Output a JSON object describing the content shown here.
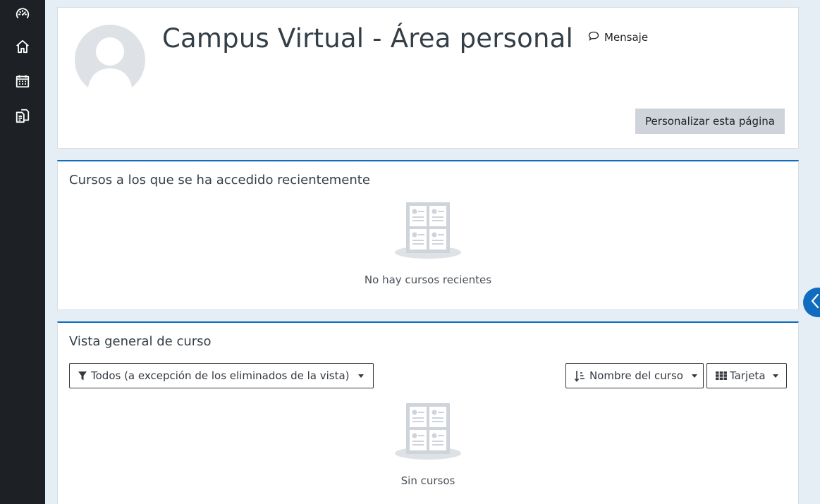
{
  "nav": {
    "items": [
      {
        "name": "dashboard-icon"
      },
      {
        "name": "home-icon"
      },
      {
        "name": "calendar-icon"
      },
      {
        "name": "files-icon"
      }
    ]
  },
  "header": {
    "title": "Campus Virtual - Área personal",
    "message_link": "Mensaje",
    "customize_button": "Personalizar esta página"
  },
  "recent_courses": {
    "title": "Cursos a los que se ha accedido recientemente",
    "empty_text": "No hay cursos recientes"
  },
  "course_overview": {
    "title": "Vista general de curso",
    "filter_dropdown": "Todos (a excepción de los eliminados de la vista)",
    "sort_dropdown": "Nombre del curso",
    "view_dropdown": "Tarjeta",
    "empty_text": "Sin cursos"
  },
  "colors": {
    "accent": "#0f6cbf",
    "rail": "#1d2125",
    "page_bg": "#e5eef5"
  }
}
